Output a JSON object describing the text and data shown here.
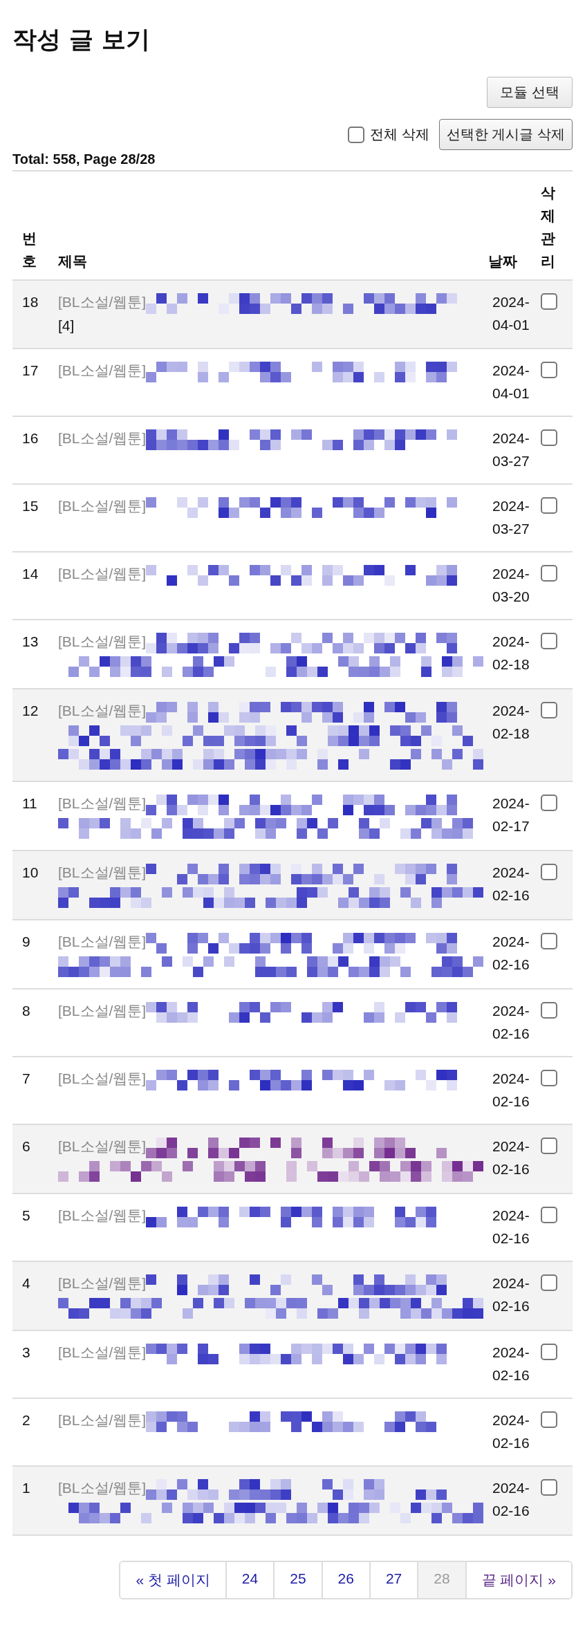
{
  "page_title": "작성 글 보기",
  "module_button": "모듈 선택",
  "select_all": {
    "label": "전체 삭제",
    "checked": false
  },
  "delete_button": "선택한 게시글 삭제",
  "summary": "Total: 558, Page 28/28",
  "table": {
    "columns": [
      "번호",
      "제목",
      "날짜",
      "삭제관리"
    ],
    "rows": [
      {
        "number": "18",
        "category": "[BL소설/웹툰]",
        "tail": "[4]",
        "date": "2024-04-01",
        "checked": false,
        "highlighted": true,
        "kind": "short",
        "visited": false
      },
      {
        "number": "17",
        "category": "[BL소설/웹툰]",
        "date": "2024-04-01",
        "checked": false,
        "highlighted": false,
        "kind": "short",
        "visited": false
      },
      {
        "number": "16",
        "category": "[BL소설/웹툰]",
        "date": "2024-03-27",
        "checked": false,
        "highlighted": false,
        "kind": "short",
        "visited": false
      },
      {
        "number": "15",
        "category": "[BL소설/웹툰]",
        "date": "2024-03-27",
        "checked": false,
        "highlighted": false,
        "kind": "short",
        "visited": false
      },
      {
        "number": "14",
        "category": "[BL소설/웹툰]",
        "date": "2024-03-20",
        "checked": false,
        "highlighted": false,
        "kind": "short",
        "visited": false
      },
      {
        "number": "13",
        "category": "[BL소설/웹툰]",
        "date": "2024-02-18",
        "checked": false,
        "highlighted": false,
        "kind": "long",
        "visited": false
      },
      {
        "number": "12",
        "category": "[BL소설/웹툰]",
        "date": "2024-02-18",
        "checked": false,
        "highlighted": true,
        "kind": "longer",
        "visited": false
      },
      {
        "number": "11",
        "category": "[BL소설/웹툰]",
        "date": "2024-02-17",
        "checked": false,
        "highlighted": false,
        "kind": "long",
        "visited": false
      },
      {
        "number": "10",
        "category": "[BL소설/웹툰]",
        "date": "2024-02-16",
        "checked": false,
        "highlighted": true,
        "kind": "long",
        "visited": false
      },
      {
        "number": "9",
        "category": "[BL소설/웹툰]",
        "date": "2024-02-16",
        "checked": false,
        "highlighted": false,
        "kind": "long",
        "visited": false
      },
      {
        "number": "8",
        "category": "[BL소설/웹툰]",
        "date": "2024-02-16",
        "checked": false,
        "highlighted": false,
        "kind": "short",
        "visited": false
      },
      {
        "number": "7",
        "category": "[BL소설/웹툰]",
        "date": "2024-02-16",
        "checked": false,
        "highlighted": false,
        "kind": "short",
        "visited": false
      },
      {
        "number": "6",
        "category": "[BL소설/웹툰]",
        "date": "2024-02-16",
        "checked": false,
        "highlighted": true,
        "kind": "long",
        "visited": true
      },
      {
        "number": "5",
        "category": "[BL소설/웹툰]",
        "date": "2024-02-16",
        "checked": false,
        "highlighted": false,
        "kind": "short",
        "visited": false
      },
      {
        "number": "4",
        "category": "[BL소설/웹툰]",
        "date": "2024-02-16",
        "checked": false,
        "highlighted": true,
        "kind": "long",
        "visited": false
      },
      {
        "number": "3",
        "category": "[BL소설/웹툰]",
        "date": "2024-02-16",
        "checked": false,
        "highlighted": false,
        "kind": "short",
        "visited": false
      },
      {
        "number": "2",
        "category": "[BL소설/웹툰]",
        "date": "2024-02-16",
        "checked": false,
        "highlighted": false,
        "kind": "short",
        "visited": false
      },
      {
        "number": "1",
        "category": "[BL소설/웹툰]",
        "date": "2024-02-16",
        "checked": false,
        "highlighted": true,
        "kind": "long",
        "visited": false
      }
    ]
  },
  "pagination": [
    {
      "label": "« 첫 페이지",
      "selected": false,
      "visited": false
    },
    {
      "label": "24",
      "selected": false,
      "visited": false
    },
    {
      "label": "25",
      "selected": false,
      "visited": false
    },
    {
      "label": "26",
      "selected": false,
      "visited": false
    },
    {
      "label": "27",
      "selected": false,
      "visited": false
    },
    {
      "label": "28",
      "selected": true,
      "visited": false
    },
    {
      "label": "끝 페이지 »",
      "selected": false,
      "visited": true
    }
  ]
}
